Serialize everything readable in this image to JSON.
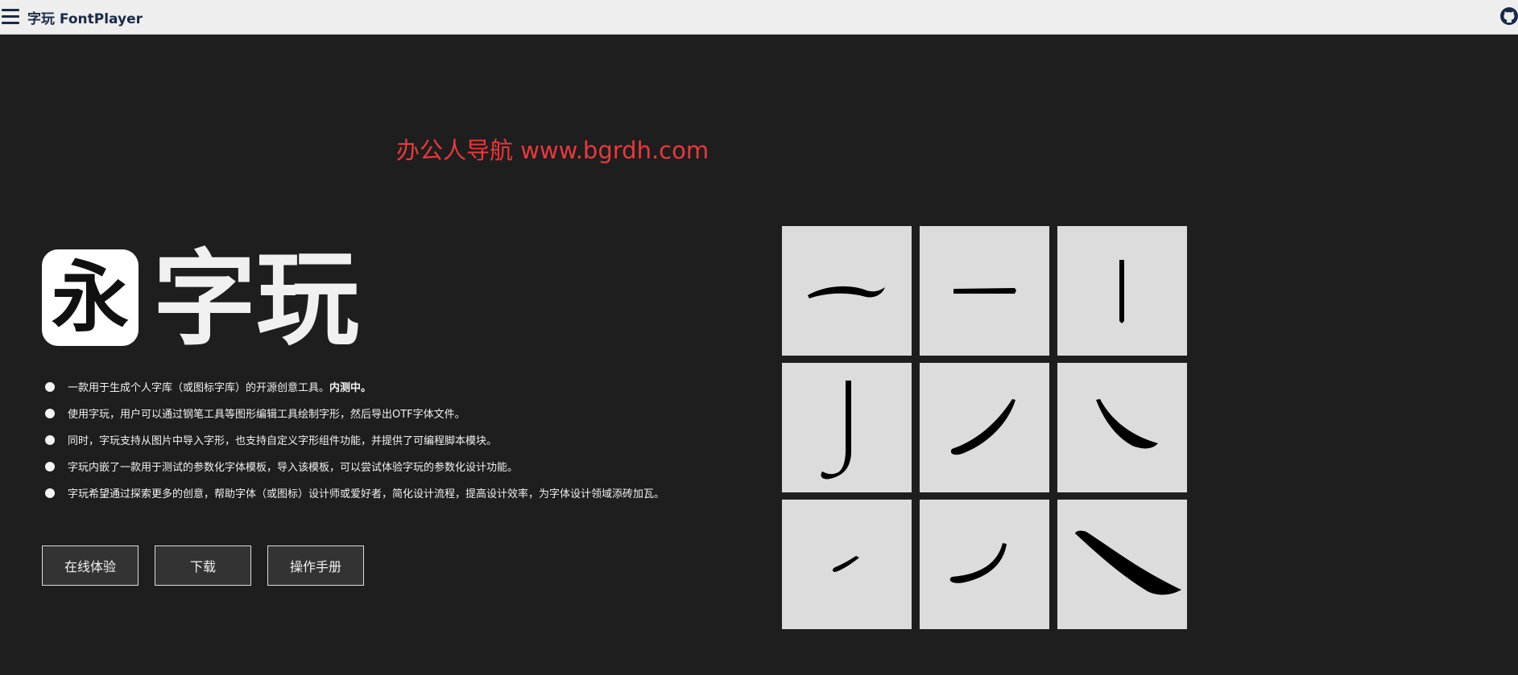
{
  "header": {
    "title": "字玩 FontPlayer",
    "menu_icon": "hamburger-menu-icon",
    "github_icon": "github-icon"
  },
  "promo": {
    "text": "办公人导航  www.bgrdh.com",
    "color": "#e8393c"
  },
  "brand": {
    "logo_glyph": "永",
    "name": "字玩"
  },
  "features": [
    {
      "text": "一款用于生成个人字库（或图标字库）的开源创意工具。",
      "bold": "内测中。"
    },
    {
      "text": "使用字玩，用户可以通过钢笔工具等图形编辑工具绘制字形，然后导出OTF字体文件。",
      "bold": ""
    },
    {
      "text": "同时，字玩支持从图片中导入字形，也支持自定义字形组件功能，并提供了可编程脚本模块。",
      "bold": ""
    },
    {
      "text": "字玩内嵌了一款用于测试的参数化字体模板，导入该模板，可以尝试体验字玩的参数化设计功能。",
      "bold": ""
    },
    {
      "text": "字玩希望通过探索更多的创意，帮助字体（或图标）设计师或爱好者，简化设计流程，提高设计效率，为字体设计领域添砖加瓦。",
      "bold": ""
    }
  ],
  "buttons": {
    "try_online": "在线体验",
    "download": "下载",
    "manual": "操作手册"
  },
  "strokes": [
    "heng-curved-stroke-icon",
    "heng-stroke-icon",
    "shu-stroke-icon",
    "shu-gou-stroke-icon",
    "pie-stroke-icon",
    "na-stroke-icon",
    "dian-stroke-icon",
    "pie-curved-stroke-icon",
    "na-long-stroke-icon"
  ],
  "colors": {
    "background": "#1e1e1e",
    "topbar": "#eeeeee",
    "tile": "#dcdcdc",
    "button": "#333333"
  }
}
